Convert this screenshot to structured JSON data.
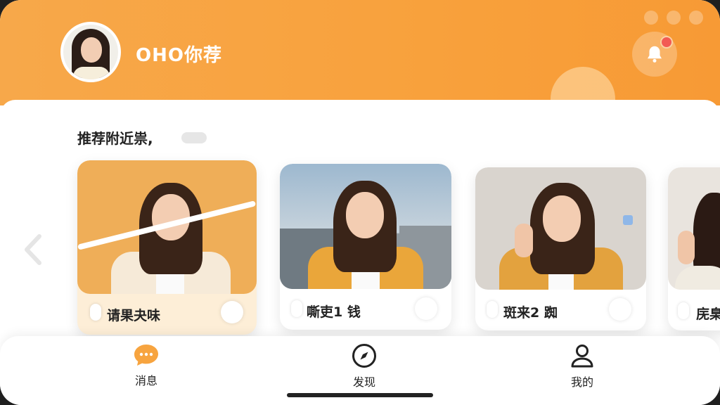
{
  "header": {
    "app_title": "OHO你荐"
  },
  "section": {
    "title": "推荐附近祟,"
  },
  "cards": [
    {
      "label": "请果夬味"
    },
    {
      "label": "嘶吏1 钱"
    },
    {
      "label": "斑来2 踟"
    },
    {
      "label": "庑臬"
    }
  ],
  "tabs": [
    {
      "label": "消息",
      "icon": "chat-bubble-icon"
    },
    {
      "label": "发现",
      "icon": "compass-icon"
    },
    {
      "label": "我的",
      "icon": "person-icon"
    }
  ],
  "colors": {
    "accent": "#f8a13c",
    "badge": "#f25a54"
  }
}
